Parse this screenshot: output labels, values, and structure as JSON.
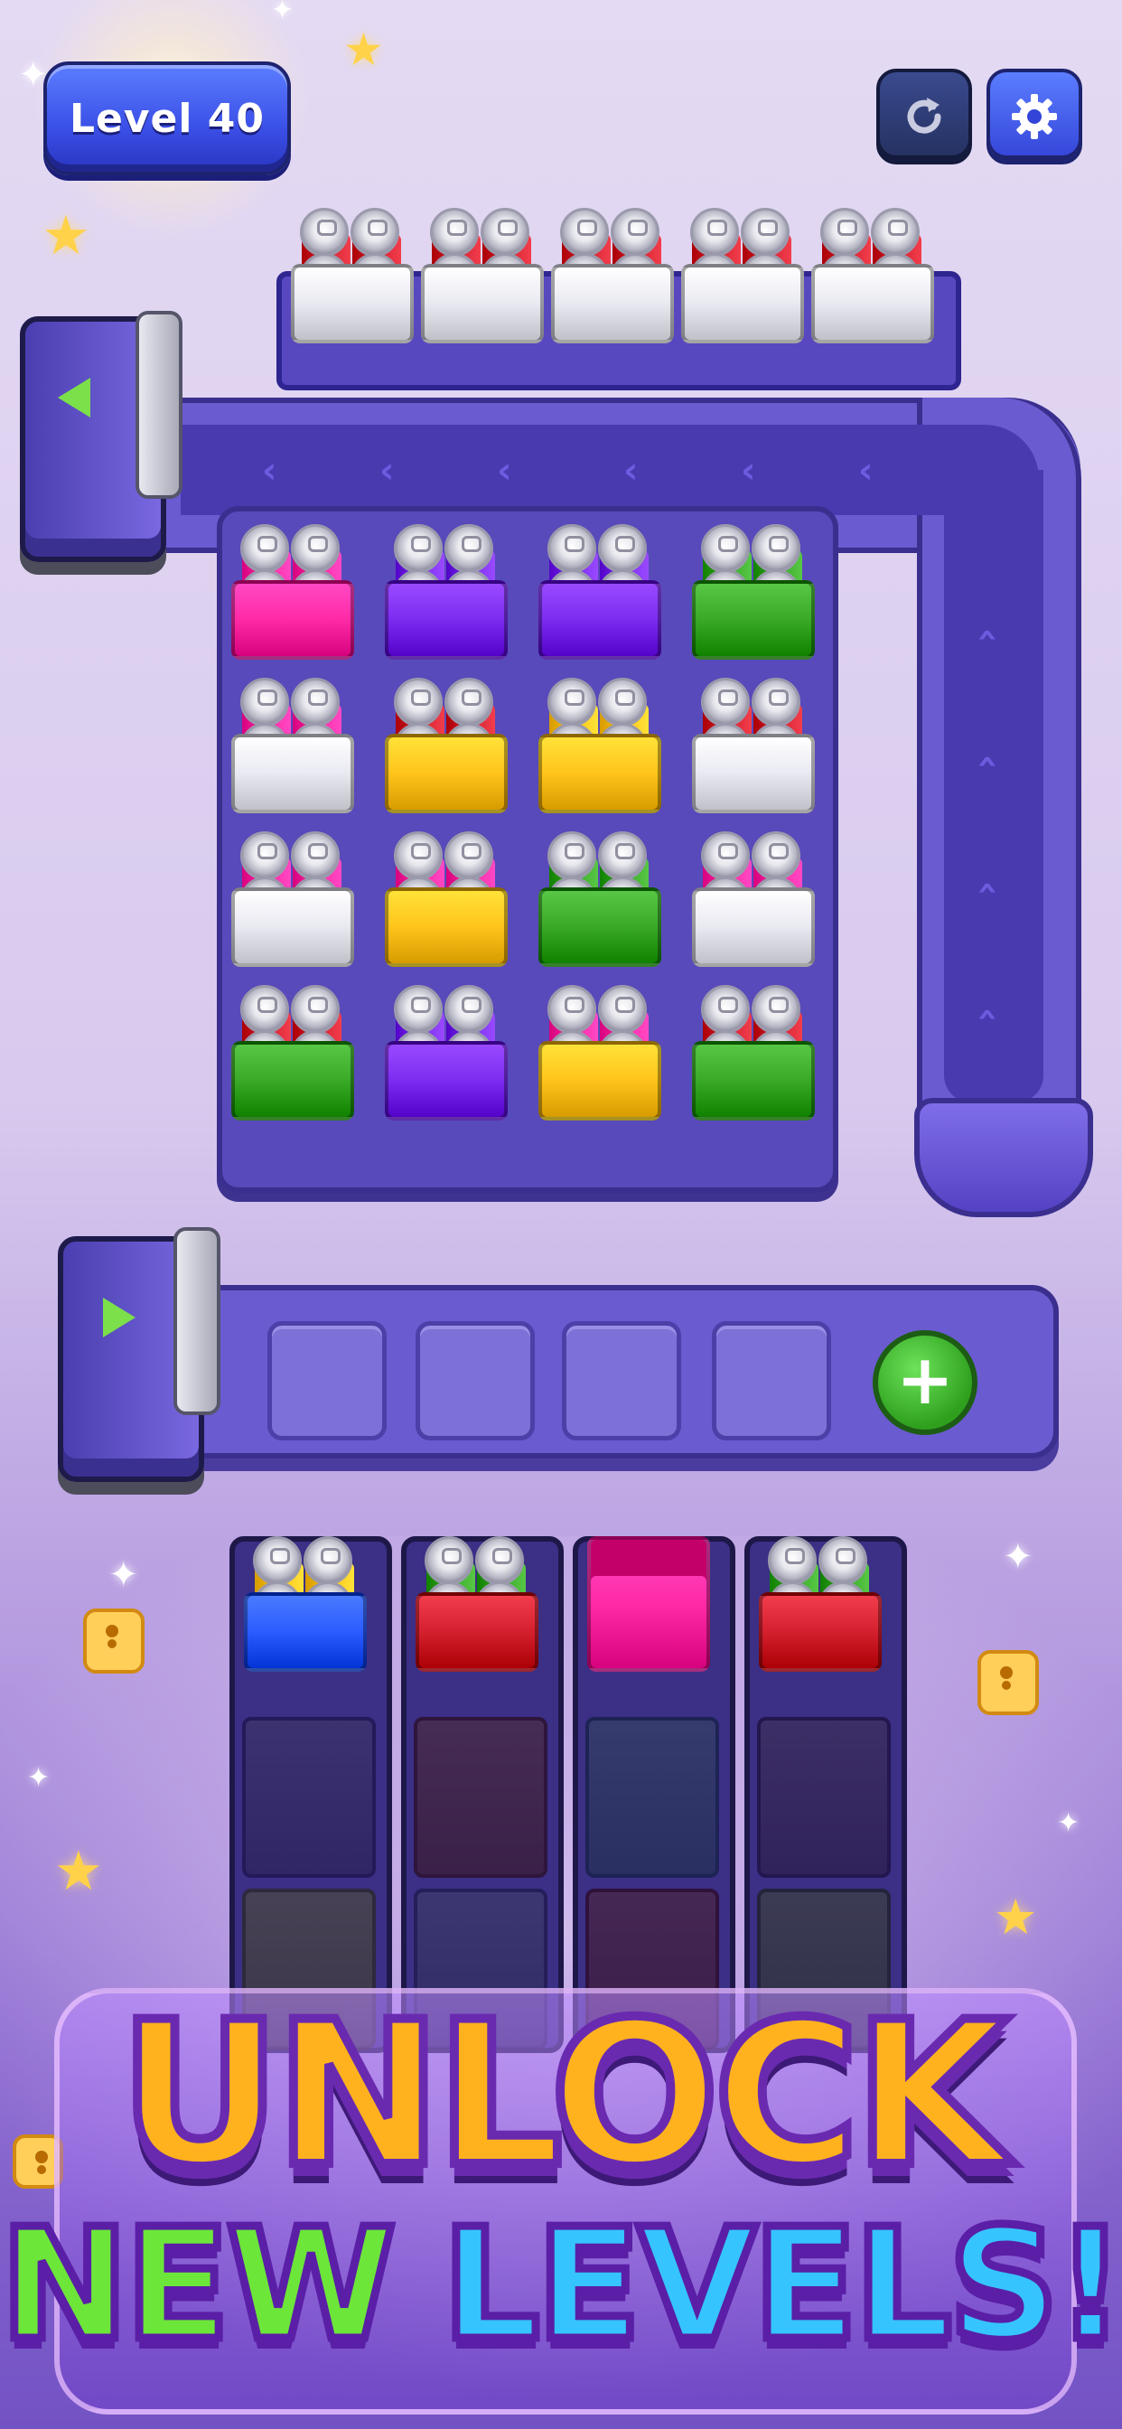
{
  "header": {
    "level_label": "Level 40",
    "restart_icon": "restart-icon",
    "settings_icon": "gear-icon"
  },
  "colors": {
    "red": "#d4202e",
    "white": "#e9e9f2",
    "magenta": "#ff2aa6",
    "purple": "#7b2cf0",
    "yellow": "#ffc41a",
    "green": "#39a927",
    "blue": "#2b5cff",
    "track": "#6a5bd0",
    "headline_orange": "#ffb21e",
    "headline_green": "#6de63a",
    "headline_blue": "#36c4ff"
  },
  "top_row": [
    {
      "box": "white",
      "cans": "red"
    },
    {
      "box": "white",
      "cans": "red"
    },
    {
      "box": "white",
      "cans": "red"
    },
    {
      "box": "white",
      "cans": "red"
    },
    {
      "box": "white",
      "cans": "red"
    }
  ],
  "grid": [
    [
      {
        "box": "magenta",
        "cans": "magenta"
      },
      {
        "box": "purple",
        "cans": "purple"
      },
      {
        "box": "purple",
        "cans": "purple"
      },
      {
        "box": "green",
        "cans": "green"
      }
    ],
    [
      {
        "box": "white",
        "cans": "magenta"
      },
      {
        "box": "yellow",
        "cans": "red"
      },
      {
        "box": "yellow",
        "cans": "yellow"
      },
      {
        "box": "white",
        "cans": "red"
      }
    ],
    [
      {
        "box": "white",
        "cans": "magenta"
      },
      {
        "box": "yellow",
        "cans": "magenta"
      },
      {
        "box": "green",
        "cans": "green"
      },
      {
        "box": "white",
        "cans": "magenta"
      }
    ],
    [
      {
        "box": "green",
        "cans": "red"
      },
      {
        "box": "purple",
        "cans": "purple"
      },
      {
        "box": "yellow",
        "cans": "magenta"
      },
      {
        "box": "green",
        "cans": "red"
      }
    ]
  ],
  "holding_slots": 4,
  "add_slot_icon": "plus-icon",
  "bottom_lanes": [
    {
      "top": {
        "box": "blue",
        "cans": "yellow"
      },
      "locked": [
        "#2a2050",
        "#3b3a20"
      ]
    },
    {
      "top": {
        "box": "red",
        "cans": "green"
      },
      "locked": [
        "#3a1820",
        "#2a2850"
      ]
    },
    {
      "top": {
        "box": "magenta",
        "cans": "none"
      },
      "locked": [
        "#20304a",
        "#3a1020"
      ]
    },
    {
      "top": {
        "box": "red",
        "cans": "green"
      },
      "locked": [
        "#2a1a3e",
        "#2a3020"
      ]
    }
  ],
  "headline": {
    "line1": "UNLOCK",
    "line2_word1": "NEW",
    "line2_word2": "LEVELS!"
  }
}
